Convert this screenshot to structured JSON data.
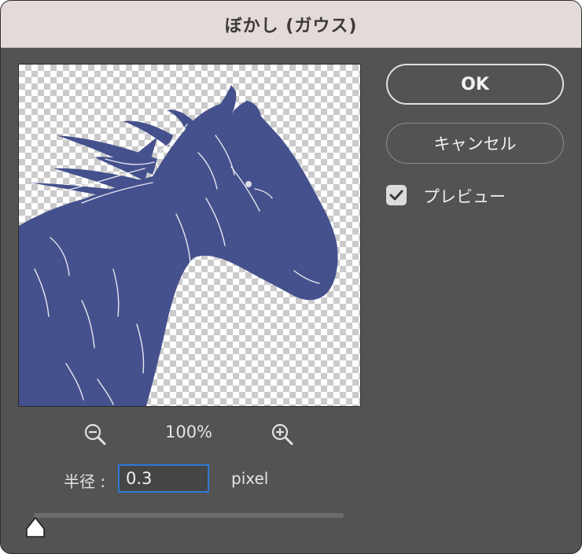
{
  "dialog": {
    "title": "ぼかし (ガウス)"
  },
  "preview_image": {
    "subject": "horse-silhouette",
    "fill_color": "#45518d"
  },
  "zoom": {
    "level": "100%",
    "zoom_out_icon": "zoom-out-icon",
    "zoom_in_icon": "zoom-in-icon"
  },
  "radius": {
    "label": "半径 :",
    "value": "0.3",
    "unit": "pixel",
    "slider_fraction": 0.0
  },
  "buttons": {
    "ok": "OK",
    "cancel": "キャンセル"
  },
  "preview_toggle": {
    "label": "プレビュー",
    "checked": true
  },
  "colors": {
    "dialog_bg": "#535353",
    "titlebar_bg": "#e3dada",
    "input_border": "#2f77d6"
  }
}
